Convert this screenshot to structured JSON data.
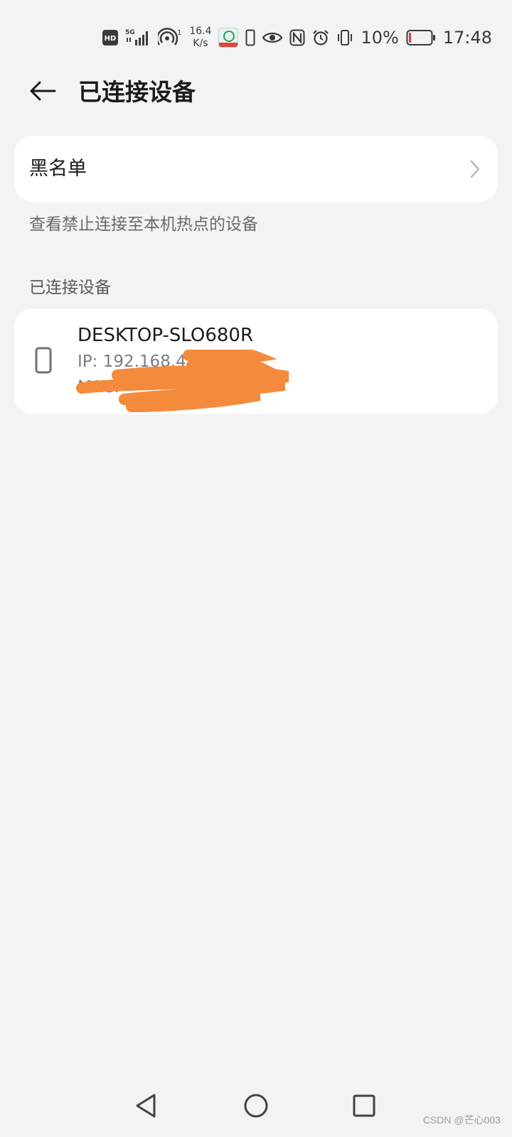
{
  "status_bar": {
    "hd": "HD",
    "network": "5G",
    "hotspot_count": "1",
    "speed_value": "16.4",
    "speed_unit": "K/s",
    "battery_percent": "10%",
    "time": "17:48",
    "battery_level": 0.1,
    "icons": [
      "hd-icon",
      "5g-signal-icon",
      "hotspot-icon",
      "carrier-app-icon",
      "phone-icon",
      "eye-icon",
      "nfc-icon",
      "alarm-icon",
      "vibrate-icon",
      "battery-icon"
    ]
  },
  "header": {
    "title": "已连接设备",
    "back_icon": "back-arrow-icon"
  },
  "blacklist": {
    "label": "黑名单",
    "hint": "查看禁止连接至本机热点的设备"
  },
  "connected": {
    "section_title": "已连接设备",
    "devices": [
      {
        "name": "DESKTOP-SLO680R",
        "ip": "IP: 192.168.4",
        "mac": "MAC: "
      }
    ]
  },
  "nav": {
    "icons": [
      "back-triangle-icon",
      "home-circle-icon",
      "recents-square-icon"
    ]
  },
  "colors": {
    "background": "#f1f3f5",
    "card": "#ffffff",
    "redaction": "#f48a3c",
    "battery_low": "#e53935"
  },
  "watermark": "CSDN @芒心003"
}
